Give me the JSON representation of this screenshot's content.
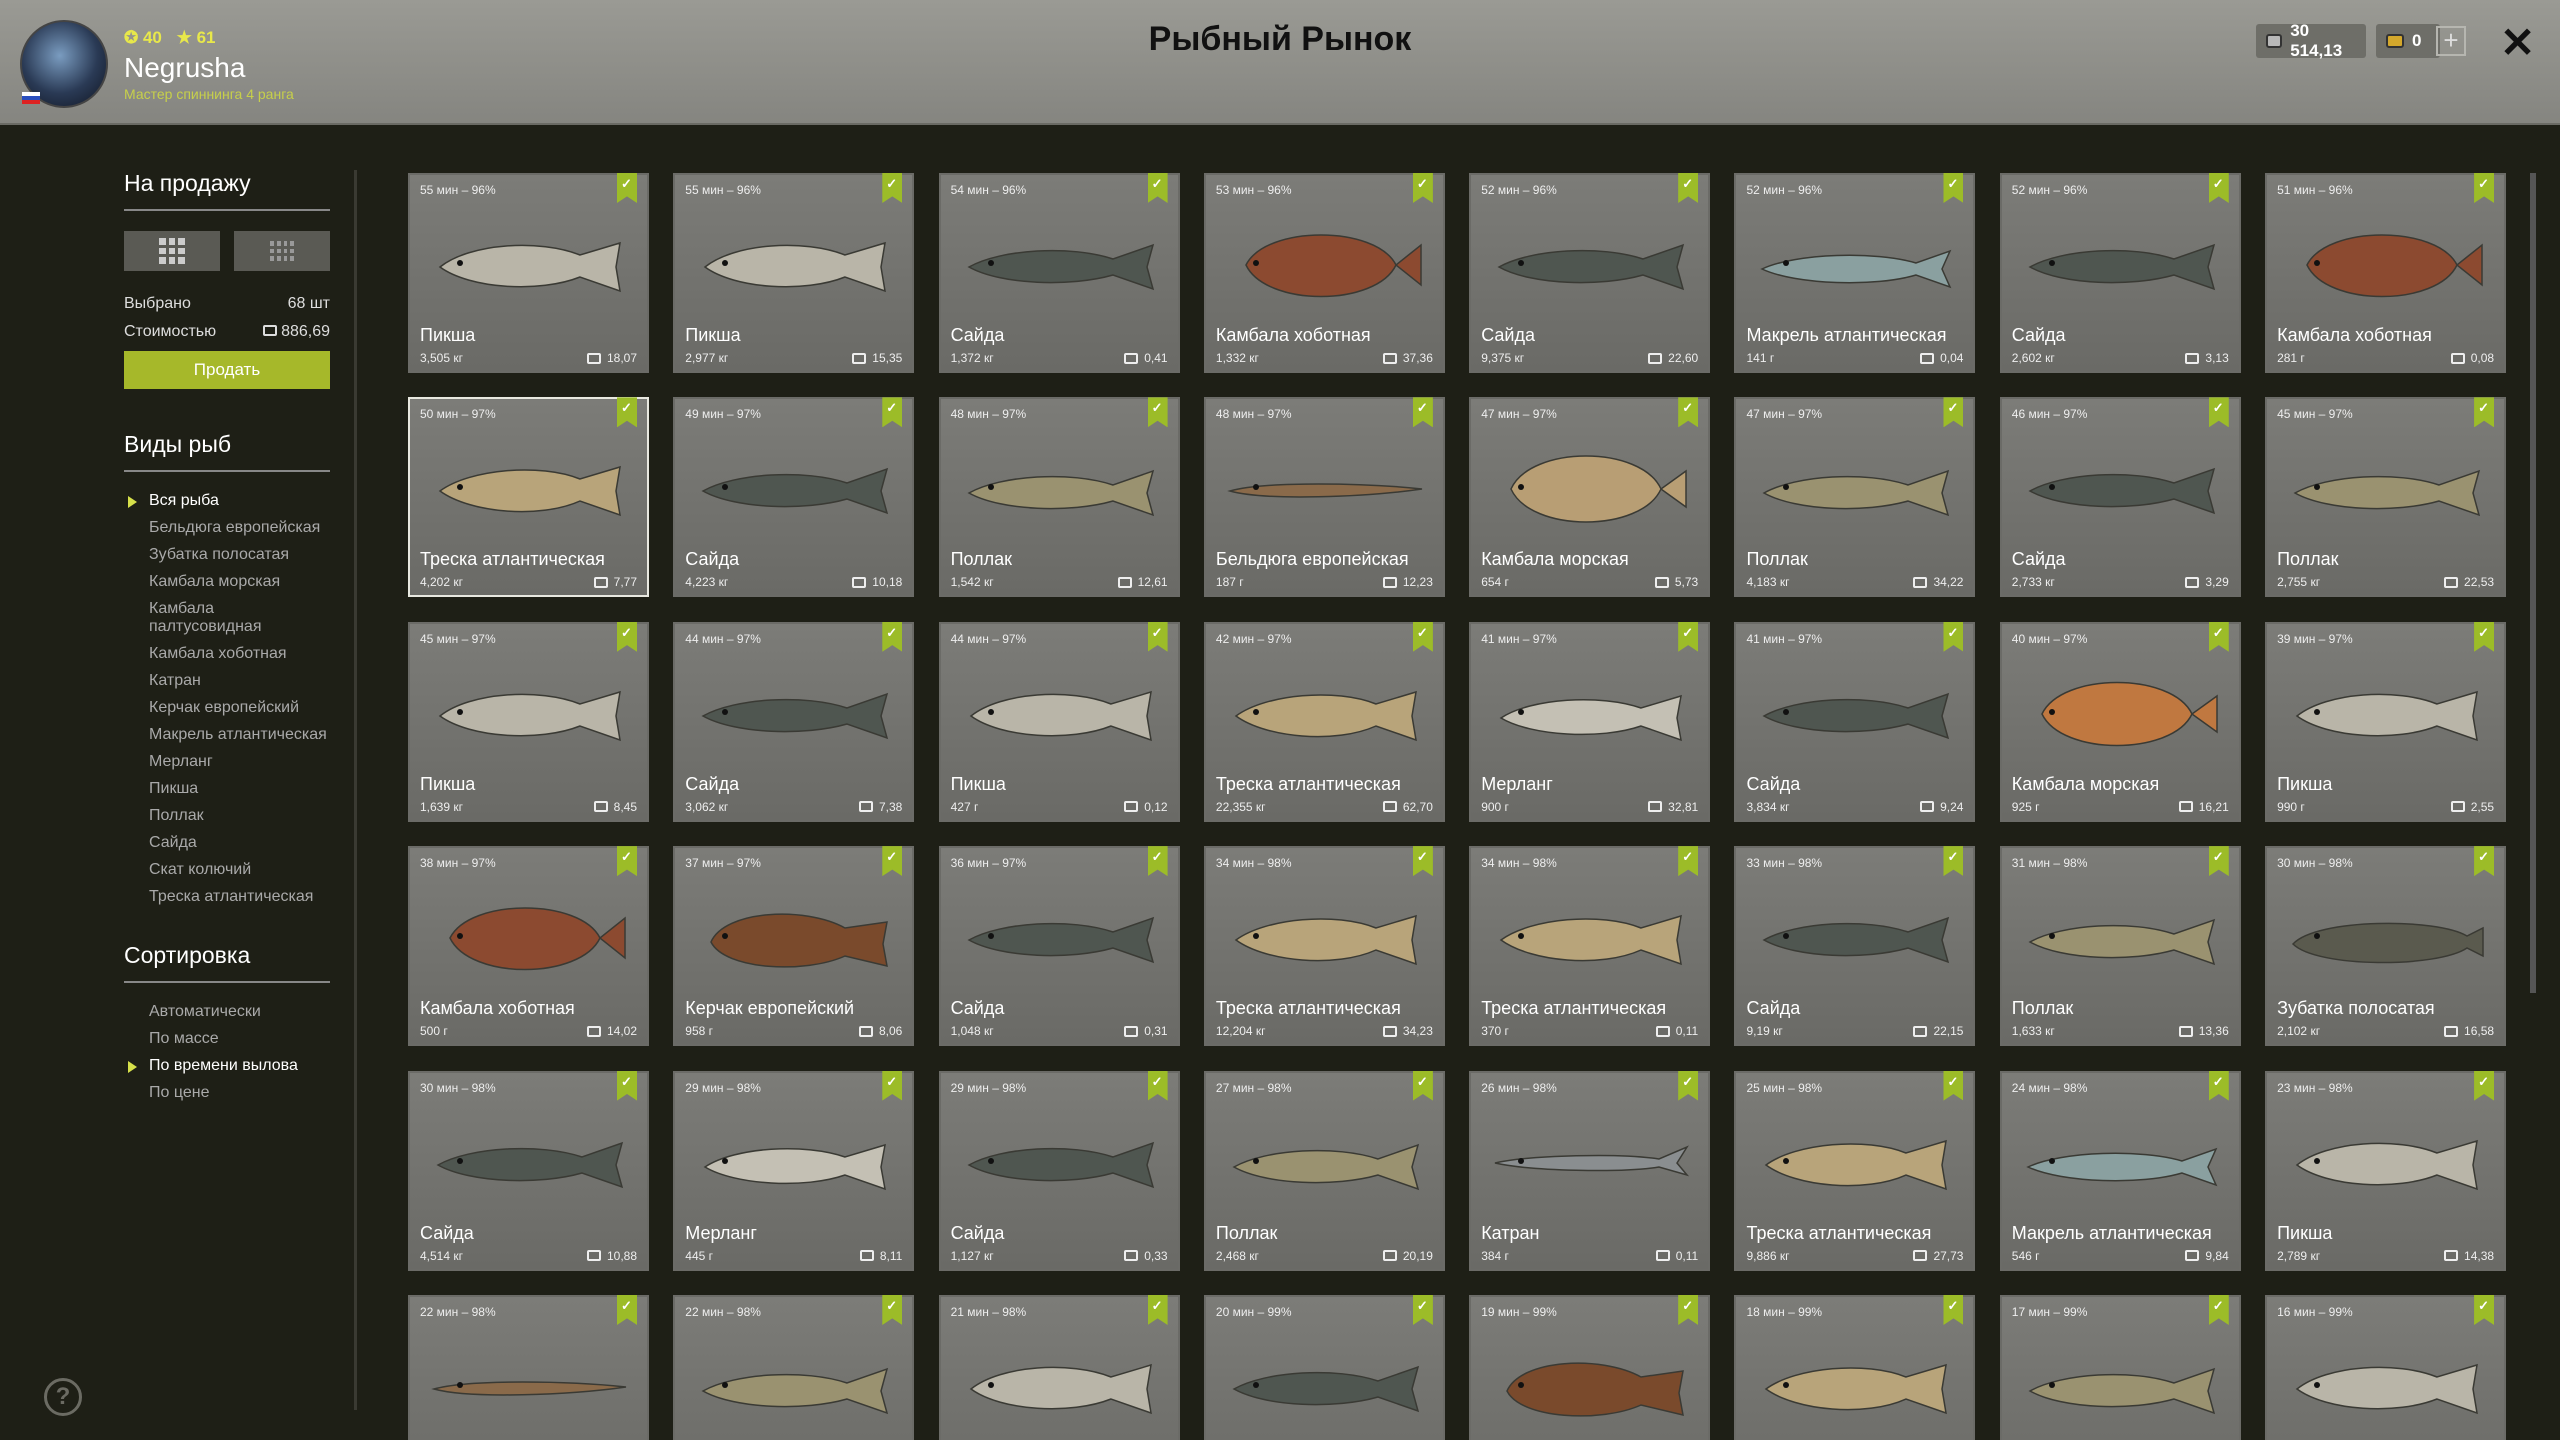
{
  "header": {
    "title": "Рыбный Рынок",
    "username": "Negrusha",
    "rank": "Мастер спиннинга 4 ранга",
    "level": "40",
    "stars": "61",
    "silver": "30 514,13",
    "gold": "0"
  },
  "sidebar": {
    "sale_title": "На продажу",
    "selected_label": "Выбрано",
    "selected_value": "68 шт",
    "cost_label": "Стоимостью",
    "cost_value": "886,69",
    "sell_button": "Продать",
    "species_title": "Виды рыб",
    "species": [
      "Вся рыба",
      "Бельдюга европейская",
      "Зубатка полосатая",
      "Камбала морская",
      "Камбала палтусовидная",
      "Камбала хоботная",
      "Катран",
      "Керчак европейский",
      "Макрель атлантическая",
      "Мерланг",
      "Пикша",
      "Поллак",
      "Сайда",
      "Скат колючий",
      "Треска атлантическая"
    ],
    "species_active": 0,
    "sort_title": "Сортировка",
    "sort": [
      "Автоматически",
      "По массе",
      "По времени вылова",
      "По цене"
    ],
    "sort_active": 2
  },
  "colors": {
    "accent": "#a6b82a",
    "flag": "#9cbc28"
  },
  "fish": [
    {
      "time": "55 мин – 96%",
      "name": "Пикша",
      "weight": "3,505 кг",
      "price": "18,07",
      "shape": "cod"
    },
    {
      "time": "55 мин – 96%",
      "name": "Пикша",
      "weight": "2,977 кг",
      "price": "15,35",
      "shape": "cod"
    },
    {
      "time": "54 мин – 96%",
      "name": "Сайда",
      "weight": "1,372 кг",
      "price": "0,41",
      "shape": "saithe"
    },
    {
      "time": "53 мин – 96%",
      "name": "Камбала хоботная",
      "weight": "1,332 кг",
      "price": "37,36",
      "shape": "flat"
    },
    {
      "time": "52 мин – 96%",
      "name": "Сайда",
      "weight": "9,375 кг",
      "price": "22,60",
      "shape": "saithe"
    },
    {
      "time": "52 мин – 96%",
      "name": "Макрель атлантическая",
      "weight": "141 г",
      "price": "0,04",
      "shape": "mackerel"
    },
    {
      "time": "52 мин – 96%",
      "name": "Сайда",
      "weight": "2,602 кг",
      "price": "3,13",
      "shape": "saithe"
    },
    {
      "time": "51 мин – 96%",
      "name": "Камбала хоботная",
      "weight": "281 г",
      "price": "0,08",
      "shape": "flat"
    },
    {
      "time": "50 мин – 97%",
      "name": "Треска атлантическая",
      "weight": "4,202 кг",
      "price": "7,77",
      "shape": "codtan",
      "selected": true
    },
    {
      "time": "49 мин – 97%",
      "name": "Сайда",
      "weight": "4,223 кг",
      "price": "10,18",
      "shape": "saithe"
    },
    {
      "time": "48 мин – 97%",
      "name": "Поллак",
      "weight": "1,542 кг",
      "price": "12,61",
      "shape": "pollack"
    },
    {
      "time": "48 мин – 97%",
      "name": "Бельдюга европейская",
      "weight": "187 г",
      "price": "12,23",
      "shape": "eel"
    },
    {
      "time": "47 мин – 97%",
      "name": "Камбала морская",
      "weight": "654 г",
      "price": "5,73",
      "shape": "flatpale"
    },
    {
      "time": "47 мин – 97%",
      "name": "Поллак",
      "weight": "4,183 кг",
      "price": "34,22",
      "shape": "pollack"
    },
    {
      "time": "46 мин – 97%",
      "name": "Сайда",
      "weight": "2,733 кг",
      "price": "3,29",
      "shape": "saithe"
    },
    {
      "time": "45 мин – 97%",
      "name": "Поллак",
      "weight": "2,755 кг",
      "price": "22,53",
      "shape": "pollack"
    },
    {
      "time": "45 мин – 97%",
      "name": "Пикша",
      "weight": "1,639 кг",
      "price": "8,45",
      "shape": "cod"
    },
    {
      "time": "44 мин – 97%",
      "name": "Сайда",
      "weight": "3,062 кг",
      "price": "7,38",
      "shape": "saithe"
    },
    {
      "time": "44 мин – 97%",
      "name": "Пикша",
      "weight": "427 г",
      "price": "0,12",
      "shape": "cod"
    },
    {
      "time": "42 мин – 97%",
      "name": "Треска атлантическая",
      "weight": "22,355 кг",
      "price": "62,70",
      "shape": "codtan"
    },
    {
      "time": "41 мин – 97%",
      "name": "Мерланг",
      "weight": "900 г",
      "price": "32,81",
      "shape": "whiting"
    },
    {
      "time": "41 мин – 97%",
      "name": "Сайда",
      "weight": "3,834 кг",
      "price": "9,24",
      "shape": "saithe"
    },
    {
      "time": "40 мин – 97%",
      "name": "Камбала морская",
      "weight": "925 г",
      "price": "16,21",
      "shape": "plaice"
    },
    {
      "time": "39 мин – 97%",
      "name": "Пикша",
      "weight": "990 г",
      "price": "2,55",
      "shape": "cod"
    },
    {
      "time": "38 мин – 97%",
      "name": "Камбала хоботная",
      "weight": "500 г",
      "price": "14,02",
      "shape": "flat"
    },
    {
      "time": "37 мин – 97%",
      "name": "Керчак европейский",
      "weight": "958 г",
      "price": "8,06",
      "shape": "sculpin"
    },
    {
      "time": "36 мин – 97%",
      "name": "Сайда",
      "weight": "1,048 кг",
      "price": "0,31",
      "shape": "saithe"
    },
    {
      "time": "34 мин – 98%",
      "name": "Треска атлантическая",
      "weight": "12,204 кг",
      "price": "34,23",
      "shape": "codtan"
    },
    {
      "time": "34 мин – 98%",
      "name": "Треска атлантическая",
      "weight": "370 г",
      "price": "0,11",
      "shape": "codtan"
    },
    {
      "time": "33 мин – 98%",
      "name": "Сайда",
      "weight": "9,19 кг",
      "price": "22,15",
      "shape": "saithe"
    },
    {
      "time": "31 мин – 98%",
      "name": "Поллак",
      "weight": "1,633 кг",
      "price": "13,36",
      "shape": "pollack"
    },
    {
      "time": "30 мин – 98%",
      "name": "Зубатка полосатая",
      "weight": "2,102 кг",
      "price": "16,58",
      "shape": "wolffish"
    },
    {
      "time": "30 мин – 98%",
      "name": "Сайда",
      "weight": "4,514 кг",
      "price": "10,88",
      "shape": "saithe"
    },
    {
      "time": "29 мин – 98%",
      "name": "Мерланг",
      "weight": "445 г",
      "price": "8,11",
      "shape": "whiting"
    },
    {
      "time": "29 мин – 98%",
      "name": "Сайда",
      "weight": "1,127 кг",
      "price": "0,33",
      "shape": "saithe"
    },
    {
      "time": "27 мин – 98%",
      "name": "Поллак",
      "weight": "2,468 кг",
      "price": "20,19",
      "shape": "pollack"
    },
    {
      "time": "26 мин – 98%",
      "name": "Катран",
      "weight": "384 г",
      "price": "0,11",
      "shape": "shark"
    },
    {
      "time": "25 мин – 98%",
      "name": "Треска атлантическая",
      "weight": "9,886 кг",
      "price": "27,73",
      "shape": "codtan"
    },
    {
      "time": "24 мин – 98%",
      "name": "Макрель атлантическая",
      "weight": "546 г",
      "price": "9,84",
      "shape": "mackerel"
    },
    {
      "time": "23 мин – 98%",
      "name": "Пикша",
      "weight": "2,789 кг",
      "price": "14,38",
      "shape": "cod"
    },
    {
      "time": "22 мин – 98%",
      "name": "",
      "weight": "",
      "price": "",
      "shape": "eel"
    },
    {
      "time": "22 мин – 98%",
      "name": "",
      "weight": "",
      "price": "",
      "shape": "pollack"
    },
    {
      "time": "21 мин – 98%",
      "name": "",
      "weight": "",
      "price": "",
      "shape": "cod"
    },
    {
      "time": "20 мин – 99%",
      "name": "",
      "weight": "",
      "price": "",
      "shape": "saithe"
    },
    {
      "time": "19 мин – 99%",
      "name": "",
      "weight": "",
      "price": "",
      "shape": "sculpin"
    },
    {
      "time": "18 мин – 99%",
      "name": "",
      "weight": "",
      "price": "",
      "shape": "codtan"
    },
    {
      "time": "17 мин – 99%",
      "name": "",
      "weight": "",
      "price": "",
      "shape": "pollack"
    },
    {
      "time": "16 мин – 99%",
      "name": "",
      "weight": "",
      "price": "",
      "shape": "cod"
    }
  ]
}
